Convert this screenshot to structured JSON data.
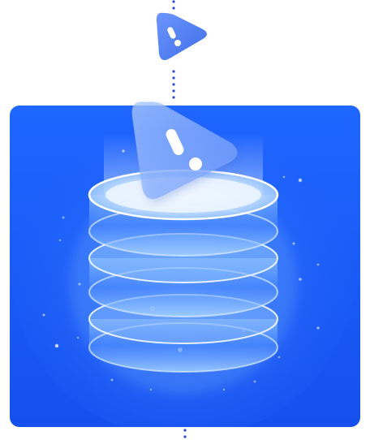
{
  "illustration": {
    "subject": "database-warning",
    "icons": [
      "warning-icon",
      "warning-icon",
      "database-icon"
    ],
    "colors": {
      "page_background": "#ffffff",
      "card_primary": "#1f63ff",
      "card_secondary": "#1656f2",
      "connector_dots": "#2a4fd6",
      "small_badge": "#4a7cf4",
      "glow": "#cfe3ff",
      "exclamation": "#ffffff"
    }
  }
}
